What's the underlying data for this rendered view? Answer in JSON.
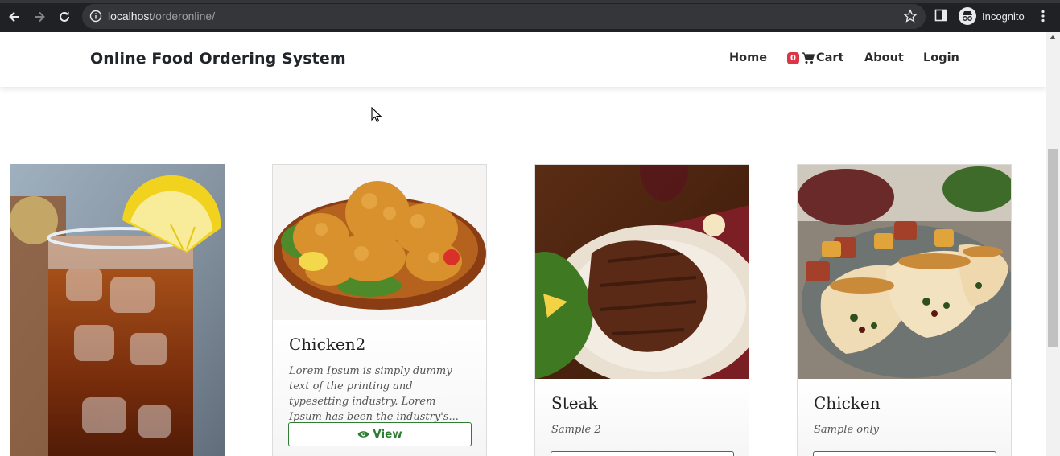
{
  "browser": {
    "url_host": "localhost",
    "url_path": "/orderonline/",
    "profile_label": "Incognito"
  },
  "navbar": {
    "brand": "Online Food Ordering System",
    "home": "Home",
    "cart_count": "0",
    "cart": "Cart",
    "about": "About",
    "login": "Login"
  },
  "products": [
    {
      "name": "",
      "description": "",
      "button": "",
      "image": "iced-tea-photo"
    },
    {
      "name": "Chicken2",
      "description": "Lorem Ipsum is simply dummy text of the printing and typesetting industry. Lorem Ipsum has been the industry's...",
      "button": "View",
      "image": "fried-chicken-photo"
    },
    {
      "name": "Steak",
      "description": "Sample 2",
      "button": "",
      "image": "steak-photo"
    },
    {
      "name": "Chicken",
      "description": "Sample only",
      "button": "",
      "image": "stuffed-chicken-photo"
    }
  ],
  "colors": {
    "accent_green": "#2e7d32",
    "badge_red": "#dc3545",
    "chrome_dark": "#202124"
  }
}
